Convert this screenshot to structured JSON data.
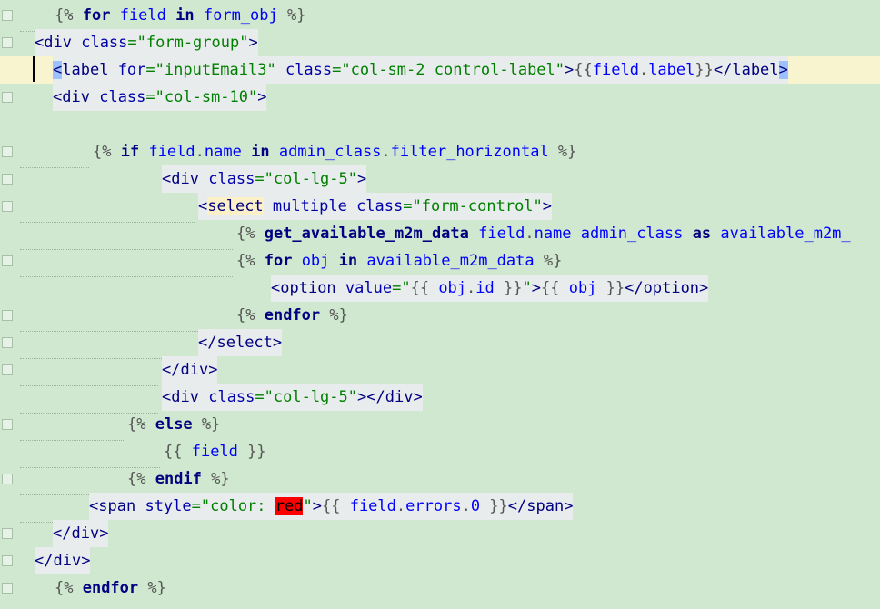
{
  "editor": {
    "lines": [
      [
        "{% ",
        "for",
        " ",
        "field",
        " ",
        "in",
        " ",
        "form_obj",
        " %}"
      ],
      [
        "<",
        "div",
        " ",
        "class",
        "=\"form-group\"",
        ">"
      ],
      [
        "<",
        "label",
        " ",
        "for",
        "=\"inputEmail3\"",
        " ",
        "class",
        "=\"col-sm-2 control-label\"",
        ">",
        "{{",
        "field",
        ".",
        "label",
        "}}",
        "</",
        "label",
        ">"
      ],
      [
        "<",
        "div",
        " ",
        "class",
        "=\"col-sm-10\"",
        ">"
      ],
      [],
      [
        "{% ",
        "if",
        " ",
        "field",
        ".",
        "name",
        " ",
        "in",
        " ",
        "admin_class",
        ".",
        "filter_horizontal",
        " %}"
      ],
      [
        "<",
        "div",
        " ",
        "class",
        "=\"col-lg-5\"",
        ">"
      ],
      [
        "<",
        "select",
        " ",
        "multiple",
        " ",
        "class",
        "=\"form-control\"",
        ">"
      ],
      [
        "{% ",
        "get_available_m2m_data",
        " ",
        "field",
        ".",
        "name",
        " ",
        "admin_class",
        " ",
        "as",
        " ",
        "available_m2m_"
      ],
      [
        "{% ",
        "for",
        " ",
        "obj",
        " ",
        "in",
        " ",
        "available_m2m_data",
        " %}"
      ],
      [
        "<",
        "option",
        " ",
        "value",
        "=\"",
        "{{ ",
        "obj",
        ".",
        "id",
        " }}",
        "\"",
        ">",
        "{{ ",
        "obj",
        " }}",
        "</",
        "option",
        ">"
      ],
      [
        "{% ",
        "endfor",
        " %}"
      ],
      [
        "</",
        "select",
        ">"
      ],
      [
        "</",
        "div",
        ">"
      ],
      [
        "<",
        "div",
        " ",
        "class",
        "=\"col-lg-5\"",
        "></",
        "div",
        ">"
      ],
      [
        "{% ",
        "else",
        " %}"
      ],
      [
        "{{ ",
        "field",
        " }}"
      ],
      [
        "{% ",
        "endif",
        " %}"
      ],
      [
        "<",
        "span",
        " ",
        "style",
        "=\"color: ",
        "red",
        "\"",
        ">",
        "{{ ",
        "field",
        ".",
        "errors",
        ".",
        "0",
        " }}",
        "</",
        "span",
        ">"
      ],
      [
        "</",
        "div",
        ">"
      ],
      [
        "</",
        "div",
        ">"
      ],
      [
        "{% ",
        "endfor",
        " %}"
      ]
    ]
  },
  "colors": {
    "background": "#cfe8cf",
    "tag": "#000080",
    "string": "#008000",
    "highlight_line": "#f7f4cf",
    "error_highlight": "#ff0000"
  },
  "icons": [
    "fold-marker-icon"
  ]
}
